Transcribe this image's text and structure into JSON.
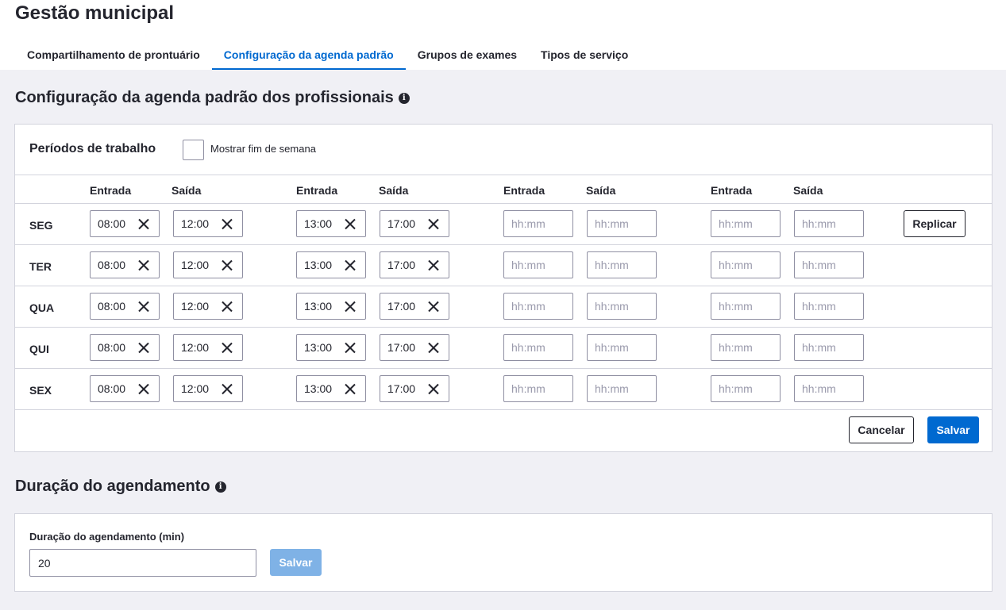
{
  "app_title": "Gestão municipal",
  "tabs": [
    {
      "label": "Compartilhamento de prontuário",
      "active": false
    },
    {
      "label": "Configuração da agenda padrão",
      "active": true
    },
    {
      "label": "Grupos de exames",
      "active": false
    },
    {
      "label": "Tipos de serviço",
      "active": false
    }
  ],
  "agenda_section": {
    "title": "Configuração da agenda padrão dos profissionais",
    "info_icon": "info-icon",
    "periods_title": "Períodos de trabalho",
    "weekend_checkbox_label": "Mostrar fim de semana",
    "weekend_checked": false,
    "column_labels": [
      "Entrada",
      "Saída",
      "Entrada",
      "Saída",
      "Entrada",
      "Saída",
      "Entrada",
      "Saída"
    ],
    "placeholder": "hh:mm",
    "days": [
      {
        "label": "SEG",
        "times": [
          "08:00",
          "12:00",
          "13:00",
          "17:00",
          "",
          "",
          "",
          ""
        ]
      },
      {
        "label": "TER",
        "times": [
          "08:00",
          "12:00",
          "13:00",
          "17:00",
          "",
          "",
          "",
          ""
        ]
      },
      {
        "label": "QUA",
        "times": [
          "08:00",
          "12:00",
          "13:00",
          "17:00",
          "",
          "",
          "",
          ""
        ]
      },
      {
        "label": "QUI",
        "times": [
          "08:00",
          "12:00",
          "13:00",
          "17:00",
          "",
          "",
          "",
          ""
        ]
      },
      {
        "label": "SEX",
        "times": [
          "08:00",
          "12:00",
          "13:00",
          "17:00",
          "",
          "",
          "",
          ""
        ]
      }
    ],
    "replicate_label": "Replicar",
    "cancel_label": "Cancelar",
    "save_label": "Salvar"
  },
  "duration_section": {
    "title": "Duração do agendamento",
    "field_label": "Duração do agendamento (min)",
    "field_value": "20",
    "save_label": "Salvar",
    "colors": {
      "primary": "#0069d0",
      "disabled": "#7fb2e6"
    }
  }
}
